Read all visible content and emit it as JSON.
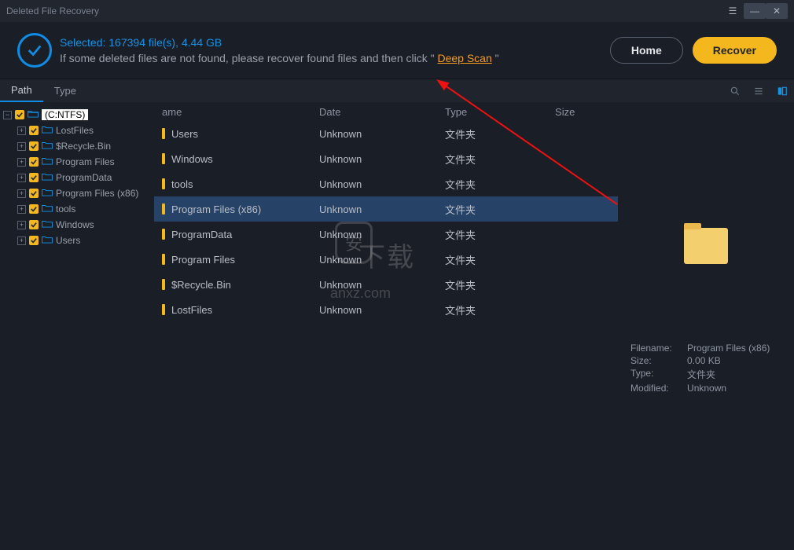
{
  "window": {
    "title": "Deleted File Recovery"
  },
  "header": {
    "selected": "Selected: 167394 file(s), 4.44 GB",
    "hint_prefix": "If some deleted files are not found, please recover found files and then click \" ",
    "deep_scan": "Deep Scan",
    "hint_suffix": " \"",
    "home": "Home",
    "recover": "Recover"
  },
  "tabs": {
    "path": "Path",
    "type": "Type"
  },
  "tree": {
    "root": "(C:NTFS)",
    "children": [
      "LostFiles",
      "$Recycle.Bin",
      "Program Files",
      "ProgramData",
      "Program Files (x86)",
      "tools",
      "Windows",
      "Users"
    ]
  },
  "columns": {
    "name": "ame",
    "date": "Date",
    "type": "Type",
    "size": "Size"
  },
  "rows": [
    {
      "name": "Users",
      "date": "Unknown",
      "type": "文件夹"
    },
    {
      "name": "Windows",
      "date": "Unknown",
      "type": "文件夹"
    },
    {
      "name": "tools",
      "date": "Unknown",
      "type": "文件夹"
    },
    {
      "name": "Program Files (x86)",
      "date": "Unknown",
      "type": "文件夹"
    },
    {
      "name": "ProgramData",
      "date": "Unknown",
      "type": "文件夹"
    },
    {
      "name": "Program Files",
      "date": "Unknown",
      "type": "文件夹"
    },
    {
      "name": "$Recycle.Bin",
      "date": "Unknown",
      "type": "文件夹"
    },
    {
      "name": "LostFiles",
      "date": "Unknown",
      "type": "文件夹"
    }
  ],
  "selected_row_index": 3,
  "details": {
    "filename_label": "Filename:",
    "filename": "Program Files (x86)",
    "size_label": "Size:",
    "size": "0.00 KB",
    "type_label": "Type:",
    "type": "文件夹",
    "modified_label": "Modified:",
    "modified": "Unknown"
  },
  "watermark": "安下载"
}
